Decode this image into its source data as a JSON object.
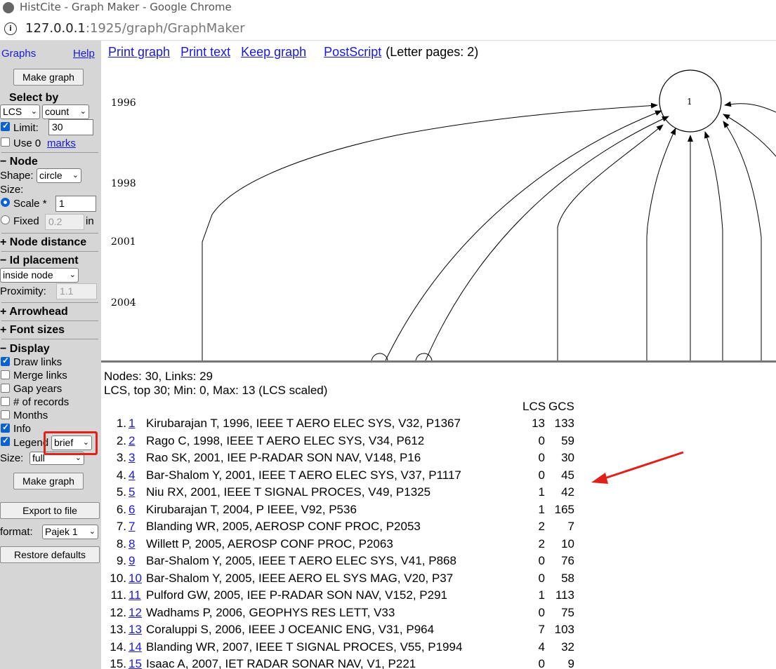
{
  "window": {
    "title": "HistCite - Graph Maker - Google Chrome",
    "url_host": "127.0.0.1",
    "url_rest": ":1925/graph/GraphMaker"
  },
  "sidebar": {
    "graphs_label": "Graphs",
    "help_label": "Help",
    "make_graph_label": "Make graph",
    "select_by_label": "Select by",
    "select_by_value": "LCS",
    "count_value": "count",
    "limit_label": "Limit:",
    "limit_value": "30",
    "use0_label": "Use 0",
    "marks_label": "marks",
    "node_section": "− Node",
    "shape_label": "Shape:",
    "shape_value": "circle",
    "size_label": "Size:",
    "scale_label": "Scale *",
    "scale_value": "1",
    "fixed_label": "Fixed",
    "fixed_value": "0.2",
    "fixed_unit": "in",
    "node_distance_section": "+ Node distance",
    "id_placement_section": "− Id placement",
    "id_placement_value": "inside node",
    "proximity_label": "Proximity:",
    "proximity_value": "1.1",
    "arrowhead_section": "+ Arrowhead",
    "font_sizes_section": "+ Font sizes",
    "display_section": "− Display",
    "draw_links_label": "Draw links",
    "merge_links_label": "Merge links",
    "gap_years_label": "Gap years",
    "records_label": "# of records",
    "months_label": "Months",
    "info_label": "Info",
    "legend_label": "Legend",
    "legend_value": "brief",
    "size2_label": "Size:",
    "size2_value": "full",
    "make_graph_label2": "Make graph",
    "export_label": "Export to file",
    "format_label": "format:",
    "format_value": "Pajek 1",
    "restore_label": "Restore defaults"
  },
  "graph_area": {
    "print_graph": "Print graph",
    "print_text": "Print text",
    "keep_graph": "Keep graph",
    "postscript": "PostScript",
    "letter_pages": "(Letter pages: 2)",
    "years": [
      "1996",
      "1998",
      "2001",
      "2004"
    ],
    "node_label": "1"
  },
  "info": {
    "line1": "Nodes: 30, Links: 29",
    "line2": "LCS, top 30; Min: 0, Max: 13 (LCS scaled)",
    "lcs_header": "LCS",
    "gcs_header": "GCS"
  },
  "records": [
    {
      "n": "1.",
      "id": "1",
      "ref": "Kirubarajan T, 1996, IEEE T AERO ELEC SYS, V32, P1367",
      "lcs": "13",
      "gcs": "133"
    },
    {
      "n": "2.",
      "id": "2",
      "ref": "Rago C, 1998, IEEE T AERO ELEC SYS, V34, P612",
      "lcs": "0",
      "gcs": "59"
    },
    {
      "n": "3.",
      "id": "3",
      "ref": "Rao SK, 2001, IEE P-RADAR SON NAV, V148, P16",
      "lcs": "0",
      "gcs": "30"
    },
    {
      "n": "4.",
      "id": "4",
      "ref": "Bar-Shalom Y, 2001, IEEE T AERO ELEC SYS, V37, P1117",
      "lcs": "0",
      "gcs": "45"
    },
    {
      "n": "5.",
      "id": "5",
      "ref": "Niu RX, 2001, IEEE T SIGNAL PROCES, V49, P1325",
      "lcs": "1",
      "gcs": "42"
    },
    {
      "n": "6.",
      "id": "6",
      "ref": "Kirubarajan T, 2004, P IEEE, V92, P536",
      "lcs": "1",
      "gcs": "165"
    },
    {
      "n": "7.",
      "id": "7",
      "ref": "Blanding WR, 2005, AEROSP CONF PROC, P2053",
      "lcs": "2",
      "gcs": "7"
    },
    {
      "n": "8.",
      "id": "8",
      "ref": "Willett P, 2005, AEROSP CONF PROC, P2063",
      "lcs": "2",
      "gcs": "10"
    },
    {
      "n": "9.",
      "id": "9",
      "ref": "Bar-Shalom Y, 2005, IEEE T AERO ELEC SYS, V41, P868",
      "lcs": "0",
      "gcs": "76"
    },
    {
      "n": "10.",
      "id": "10",
      "ref": "Bar-Shalom Y, 2005, IEEE AERO EL SYS MAG, V20, P37",
      "lcs": "0",
      "gcs": "58"
    },
    {
      "n": "11.",
      "id": "11",
      "ref": "Pulford GW, 2005, IEE P-RADAR SON NAV, V152, P291",
      "lcs": "1",
      "gcs": "113"
    },
    {
      "n": "12.",
      "id": "12",
      "ref": "Wadhams P, 2006, GEOPHYS RES LETT, V33",
      "lcs": "0",
      "gcs": "75"
    },
    {
      "n": "13.",
      "id": "13",
      "ref": "Coraluppi S, 2006, IEEE J OCEANIC ENG, V31, P964",
      "lcs": "7",
      "gcs": "103"
    },
    {
      "n": "14.",
      "id": "14",
      "ref": "Blanding WR, 2007, IEEE T SIGNAL PROCES, V55, P1994",
      "lcs": "4",
      "gcs": "32"
    },
    {
      "n": "15.",
      "id": "15",
      "ref": "Isaac A, 2007, IET RADAR SONAR NAV, V1, P221",
      "lcs": "0",
      "gcs": "9"
    }
  ],
  "colors": {
    "sidebar_bg": "#d6d6d6",
    "link": "#1a1ad6",
    "highlight": "#e0201a",
    "checkbox": "#0a62d0"
  },
  "icons": [
    "info-icon",
    "chrome-icon",
    "chevron-down-icon",
    "red-arrow-annotation"
  ]
}
